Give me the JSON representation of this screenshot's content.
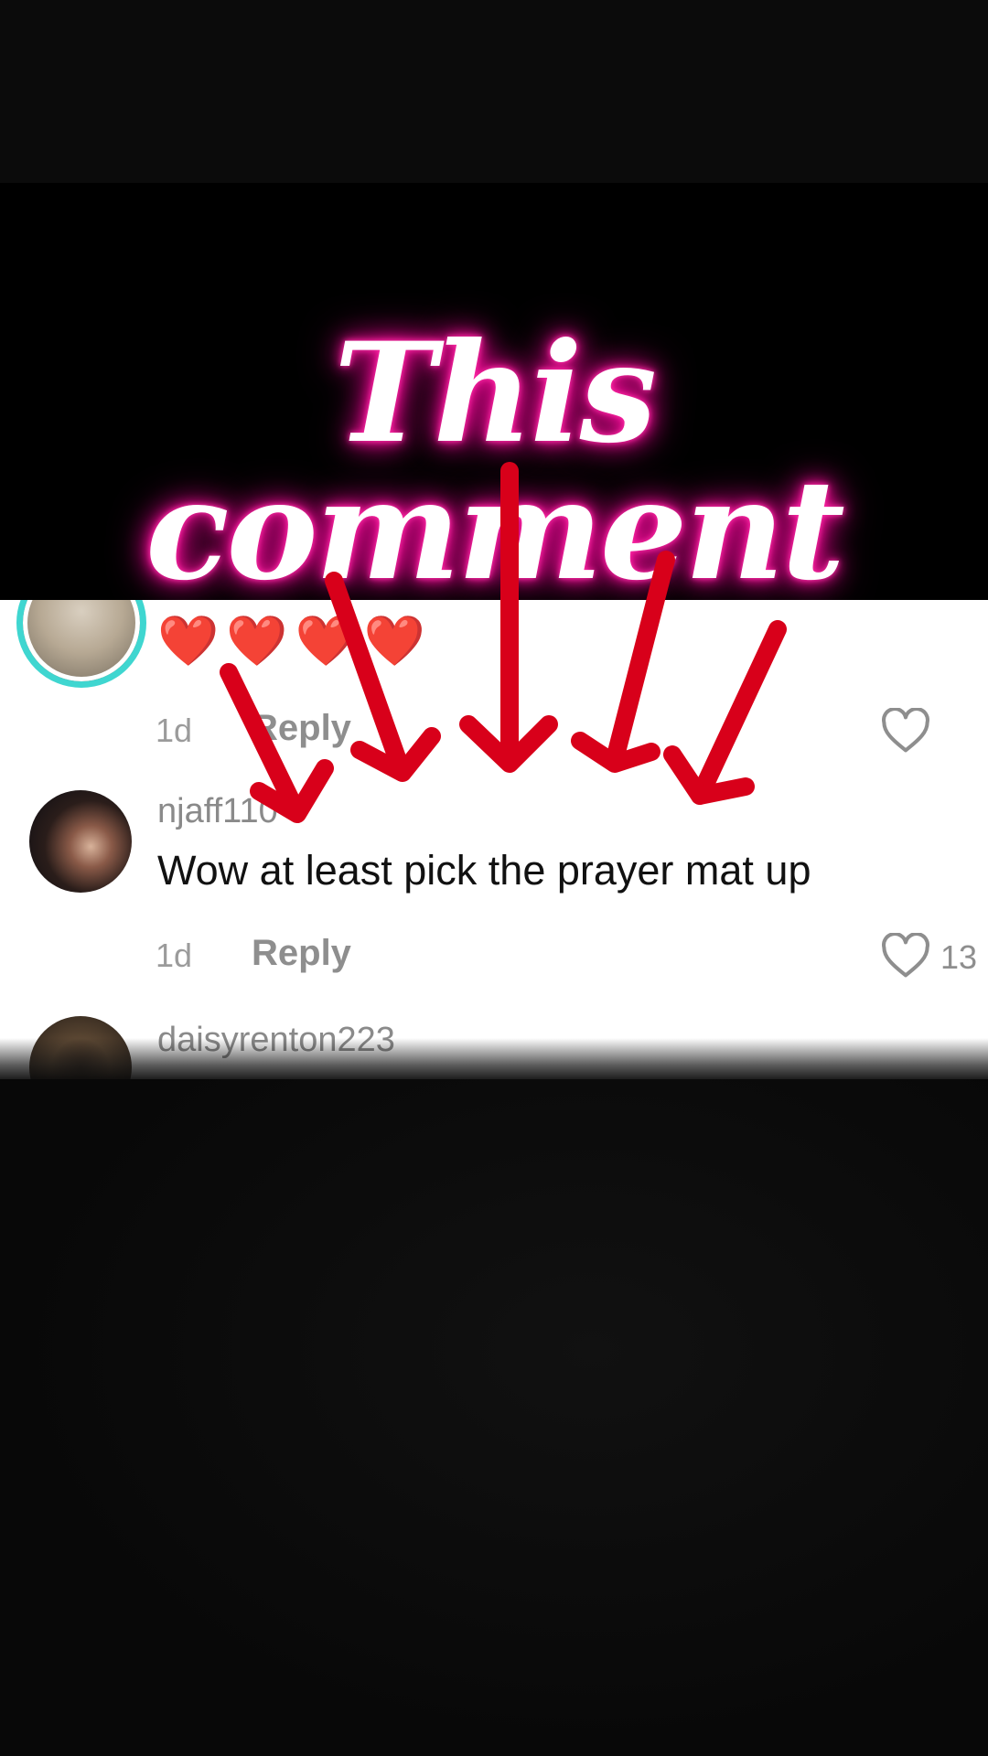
{
  "overlay": {
    "title": "This comment"
  },
  "comments": [
    {
      "text": "❤️❤️❤️❤️",
      "time": "1d",
      "reply_label": "Reply",
      "like_count": ""
    },
    {
      "username": "njaff110",
      "text": "Wow at least pick the prayer mat up",
      "time": "1d",
      "reply_label": "Reply",
      "like_count": "13"
    },
    {
      "username": "daisyrenton223"
    }
  ],
  "colors": {
    "glow": "#ff1aa0",
    "arrow": "#d8001a",
    "avatar_ring": "#3fd6d0"
  },
  "icons": {
    "like": "heart-outline-icon"
  }
}
